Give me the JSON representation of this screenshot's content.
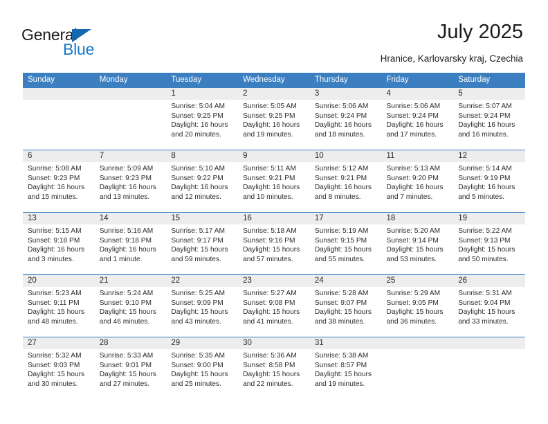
{
  "logo": {
    "word_top": "General",
    "word_bottom": "Blue",
    "triangle_icon": "blue-triangle-icon",
    "accent_color": "#1878c8"
  },
  "header": {
    "title": "July 2025",
    "subtitle": "Hranice, Karlovarsky kraj, Czechia"
  },
  "theme": {
    "header_band": "#3c7fc1",
    "daynum_band": "#ededed",
    "text": "#2b2b2b"
  },
  "calendar": {
    "weekday_headers": [
      "Sunday",
      "Monday",
      "Tuesday",
      "Wednesday",
      "Thursday",
      "Friday",
      "Saturday"
    ],
    "weeks": [
      [
        {
          "day": "",
          "details": ""
        },
        {
          "day": "",
          "details": ""
        },
        {
          "day": "1",
          "details": "Sunrise: 5:04 AM\nSunset: 9:25 PM\nDaylight: 16 hours and 20 minutes."
        },
        {
          "day": "2",
          "details": "Sunrise: 5:05 AM\nSunset: 9:25 PM\nDaylight: 16 hours and 19 minutes."
        },
        {
          "day": "3",
          "details": "Sunrise: 5:06 AM\nSunset: 9:24 PM\nDaylight: 16 hours and 18 minutes."
        },
        {
          "day": "4",
          "details": "Sunrise: 5:06 AM\nSunset: 9:24 PM\nDaylight: 16 hours and 17 minutes."
        },
        {
          "day": "5",
          "details": "Sunrise: 5:07 AM\nSunset: 9:24 PM\nDaylight: 16 hours and 16 minutes."
        }
      ],
      [
        {
          "day": "6",
          "details": "Sunrise: 5:08 AM\nSunset: 9:23 PM\nDaylight: 16 hours and 15 minutes."
        },
        {
          "day": "7",
          "details": "Sunrise: 5:09 AM\nSunset: 9:23 PM\nDaylight: 16 hours and 13 minutes."
        },
        {
          "day": "8",
          "details": "Sunrise: 5:10 AM\nSunset: 9:22 PM\nDaylight: 16 hours and 12 minutes."
        },
        {
          "day": "9",
          "details": "Sunrise: 5:11 AM\nSunset: 9:21 PM\nDaylight: 16 hours and 10 minutes."
        },
        {
          "day": "10",
          "details": "Sunrise: 5:12 AM\nSunset: 9:21 PM\nDaylight: 16 hours and 8 minutes."
        },
        {
          "day": "11",
          "details": "Sunrise: 5:13 AM\nSunset: 9:20 PM\nDaylight: 16 hours and 7 minutes."
        },
        {
          "day": "12",
          "details": "Sunrise: 5:14 AM\nSunset: 9:19 PM\nDaylight: 16 hours and 5 minutes."
        }
      ],
      [
        {
          "day": "13",
          "details": "Sunrise: 5:15 AM\nSunset: 9:18 PM\nDaylight: 16 hours and 3 minutes."
        },
        {
          "day": "14",
          "details": "Sunrise: 5:16 AM\nSunset: 9:18 PM\nDaylight: 16 hours and 1 minute."
        },
        {
          "day": "15",
          "details": "Sunrise: 5:17 AM\nSunset: 9:17 PM\nDaylight: 15 hours and 59 minutes."
        },
        {
          "day": "16",
          "details": "Sunrise: 5:18 AM\nSunset: 9:16 PM\nDaylight: 15 hours and 57 minutes."
        },
        {
          "day": "17",
          "details": "Sunrise: 5:19 AM\nSunset: 9:15 PM\nDaylight: 15 hours and 55 minutes."
        },
        {
          "day": "18",
          "details": "Sunrise: 5:20 AM\nSunset: 9:14 PM\nDaylight: 15 hours and 53 minutes."
        },
        {
          "day": "19",
          "details": "Sunrise: 5:22 AM\nSunset: 9:13 PM\nDaylight: 15 hours and 50 minutes."
        }
      ],
      [
        {
          "day": "20",
          "details": "Sunrise: 5:23 AM\nSunset: 9:11 PM\nDaylight: 15 hours and 48 minutes."
        },
        {
          "day": "21",
          "details": "Sunrise: 5:24 AM\nSunset: 9:10 PM\nDaylight: 15 hours and 46 minutes."
        },
        {
          "day": "22",
          "details": "Sunrise: 5:25 AM\nSunset: 9:09 PM\nDaylight: 15 hours and 43 minutes."
        },
        {
          "day": "23",
          "details": "Sunrise: 5:27 AM\nSunset: 9:08 PM\nDaylight: 15 hours and 41 minutes."
        },
        {
          "day": "24",
          "details": "Sunrise: 5:28 AM\nSunset: 9:07 PM\nDaylight: 15 hours and 38 minutes."
        },
        {
          "day": "25",
          "details": "Sunrise: 5:29 AM\nSunset: 9:05 PM\nDaylight: 15 hours and 36 minutes."
        },
        {
          "day": "26",
          "details": "Sunrise: 5:31 AM\nSunset: 9:04 PM\nDaylight: 15 hours and 33 minutes."
        }
      ],
      [
        {
          "day": "27",
          "details": "Sunrise: 5:32 AM\nSunset: 9:03 PM\nDaylight: 15 hours and 30 minutes."
        },
        {
          "day": "28",
          "details": "Sunrise: 5:33 AM\nSunset: 9:01 PM\nDaylight: 15 hours and 27 minutes."
        },
        {
          "day": "29",
          "details": "Sunrise: 5:35 AM\nSunset: 9:00 PM\nDaylight: 15 hours and 25 minutes."
        },
        {
          "day": "30",
          "details": "Sunrise: 5:36 AM\nSunset: 8:58 PM\nDaylight: 15 hours and 22 minutes."
        },
        {
          "day": "31",
          "details": "Sunrise: 5:38 AM\nSunset: 8:57 PM\nDaylight: 15 hours and 19 minutes."
        },
        {
          "day": "",
          "details": ""
        },
        {
          "day": "",
          "details": ""
        }
      ]
    ]
  }
}
